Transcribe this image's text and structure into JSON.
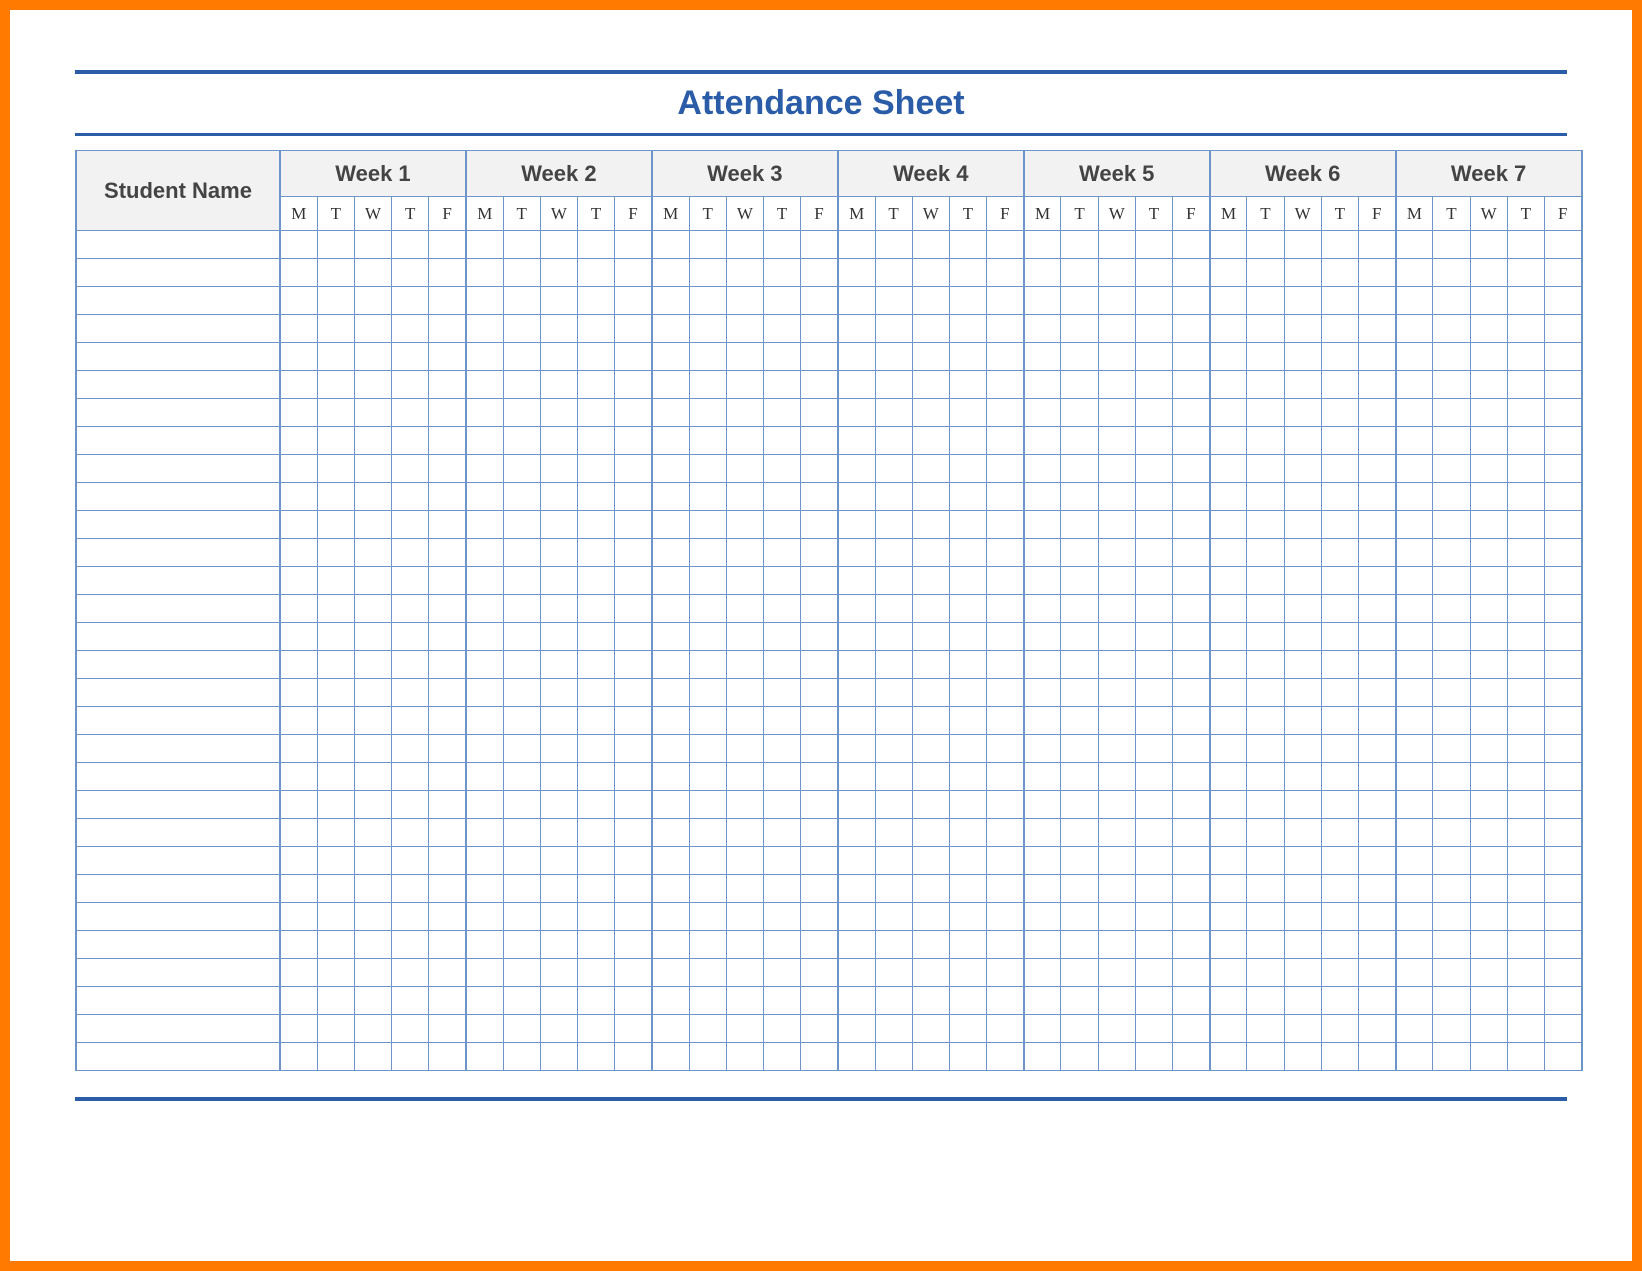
{
  "title": "Attendance Sheet",
  "name_header": "Student Name",
  "weeks": [
    "Week 1",
    "Week 2",
    "Week 3",
    "Week 4",
    "Week 5",
    "Week 6",
    "Week 7"
  ],
  "days": [
    "M",
    "T",
    "W",
    "T",
    "F"
  ],
  "row_count": 30,
  "chart_data": {
    "type": "table",
    "title": "Attendance Sheet",
    "row_label": "Student Name",
    "column_groups": [
      "Week 1",
      "Week 2",
      "Week 3",
      "Week 4",
      "Week 5",
      "Week 6",
      "Week 7"
    ],
    "columns_per_group": [
      "M",
      "T",
      "W",
      "T",
      "F"
    ],
    "rows": 30,
    "values": null
  }
}
